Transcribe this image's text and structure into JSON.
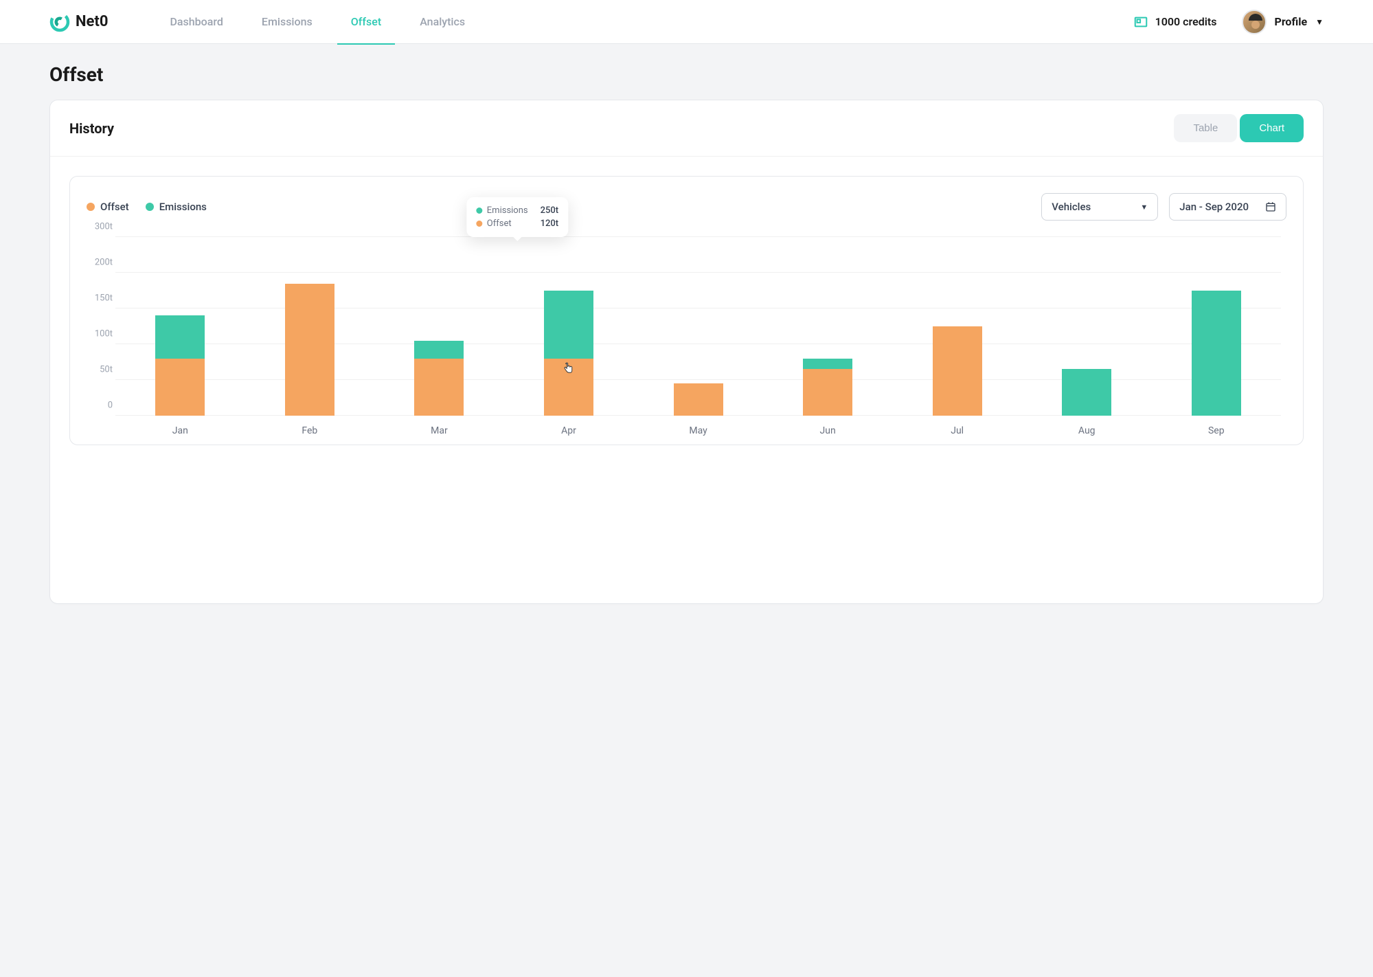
{
  "brand": {
    "name": "Net0"
  },
  "nav": {
    "items": [
      {
        "label": "Dashboard",
        "active": false
      },
      {
        "label": "Emissions",
        "active": false
      },
      {
        "label": "Offset",
        "active": true
      },
      {
        "label": "Analytics",
        "active": false
      }
    ]
  },
  "header": {
    "credits_label": "1000 credits",
    "profile_label": "Profile"
  },
  "page": {
    "title": "Offset"
  },
  "history": {
    "title": "History",
    "toggle": {
      "table": "Table",
      "chart": "Chart",
      "active": "chart"
    },
    "legend": {
      "offset": "Offset",
      "emissions": "Emissions"
    },
    "filter_selected": "Vehicles",
    "daterange": "Jan - Sep 2020"
  },
  "tooltip": {
    "rows": [
      {
        "label": "Emissions",
        "value": "250t",
        "color": "green"
      },
      {
        "label": "Offset",
        "value": "120t",
        "color": "orange"
      }
    ]
  },
  "chart_data": {
    "type": "bar",
    "stacked": true,
    "title": "History",
    "xlabel": "",
    "ylabel": "",
    "ylim": [
      0,
      300
    ],
    "yticks": [
      "0",
      "50t",
      "100t",
      "150t",
      "200t",
      "300t"
    ],
    "ytick_values": [
      0,
      50,
      100,
      150,
      200,
      300
    ],
    "categories": [
      "Jan",
      "Feb",
      "Mar",
      "Apr",
      "May",
      "Jun",
      "Jul",
      "Aug",
      "Sep"
    ],
    "series": [
      {
        "name": "Offset",
        "color": "#f5a560",
        "values": [
          80,
          185,
          80,
          80,
          45,
          65,
          125,
          0,
          0
        ]
      },
      {
        "name": "Emissions",
        "color": "#3ec9a7",
        "values": [
          60,
          0,
          25,
          95,
          0,
          15,
          0,
          65,
          175
        ]
      }
    ],
    "legend_position": "top-left",
    "grid": true,
    "tooltip_note": "Tooltip on Apr shows Emissions 250t, Offset 120t (values differ from bar heights read from axes)"
  }
}
